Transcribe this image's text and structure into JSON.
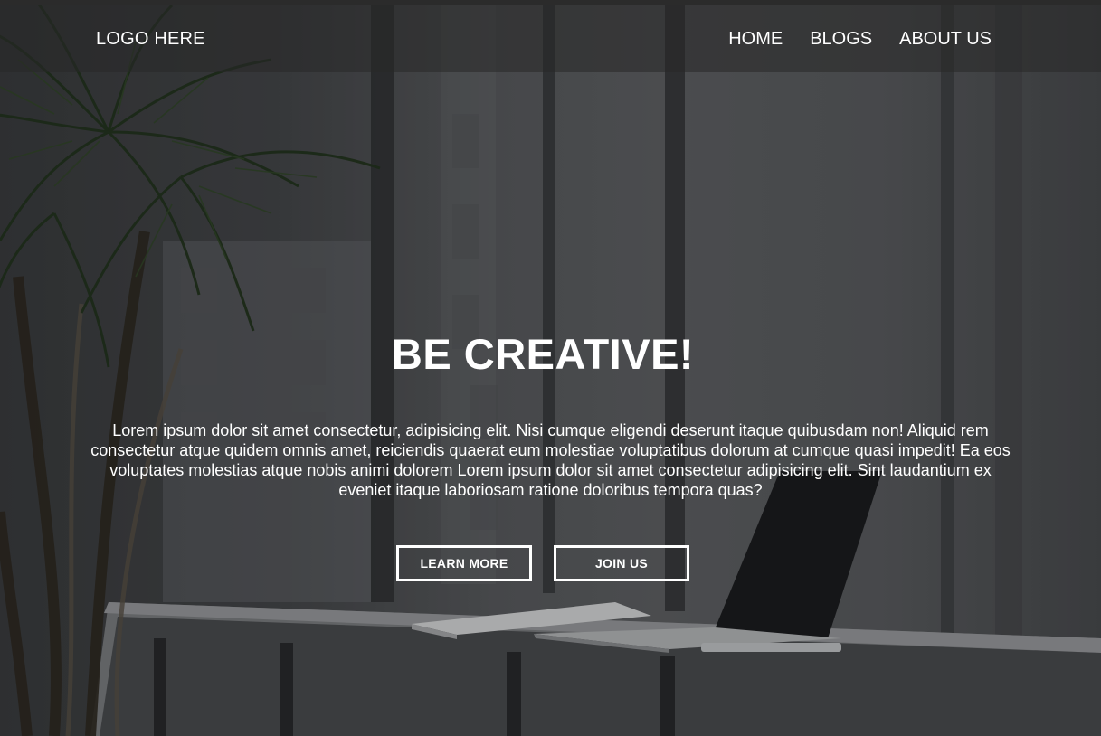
{
  "navbar": {
    "logo": "LOGO HERE",
    "links": [
      {
        "label": "HOME"
      },
      {
        "label": "BLOGS"
      },
      {
        "label": "ABOUT US"
      }
    ]
  },
  "hero": {
    "headline": "BE CREATIVE!",
    "lead": "Lorem ipsum dolor sit amet consectetur, adipisicing elit. Nisi cumque eligendi deserunt itaque quibusdam non! Aliquid rem consectetur atque quidem omnis amet, reiciendis quaerat eum molestiae voluptatibus dolorum at cumque quasi impedit! Ea eos voluptates molestias atque nobis animi dolorem Lorem ipsum dolor sit amet consectetur adipisicing elit. Sint laudantium ex eveniet itaque laboriosam ratione doloribus tempora quas?",
    "buttons": {
      "learn_more": "LEARN MORE",
      "join_us": "JOIN US"
    }
  },
  "colors": {
    "overlay": "#282828",
    "text": "#ffffff"
  }
}
